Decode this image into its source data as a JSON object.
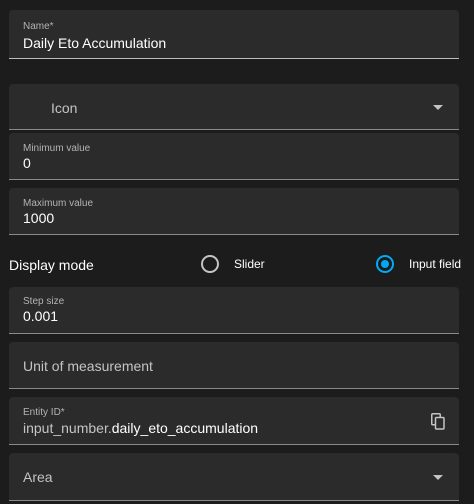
{
  "name_field": {
    "label": "Name*",
    "value": "Daily Eto Accumulation"
  },
  "icon_field": {
    "placeholder": "Icon"
  },
  "minimum_field": {
    "label": "Minimum value",
    "value": "0"
  },
  "maximum_field": {
    "label": "Maximum value",
    "value": "1000"
  },
  "display_mode": {
    "label": "Display mode",
    "options": [
      {
        "label": "Slider",
        "selected": false
      },
      {
        "label": "Input field",
        "selected": true
      }
    ]
  },
  "step_field": {
    "label": "Step size",
    "value": "0.001"
  },
  "unit_field": {
    "placeholder": "Unit of measurement"
  },
  "entity_field": {
    "label": "Entity ID*",
    "prefix": "input_number.",
    "value": "daily_eto_accumulation"
  },
  "area_field": {
    "placeholder": "Area"
  },
  "icons": {
    "copy": "copy-icon",
    "dropdown": "chevron-down-icon"
  },
  "colors": {
    "accent": "#03a9f4",
    "surface": "#2b2b2b",
    "background": "#1c1c1c"
  }
}
